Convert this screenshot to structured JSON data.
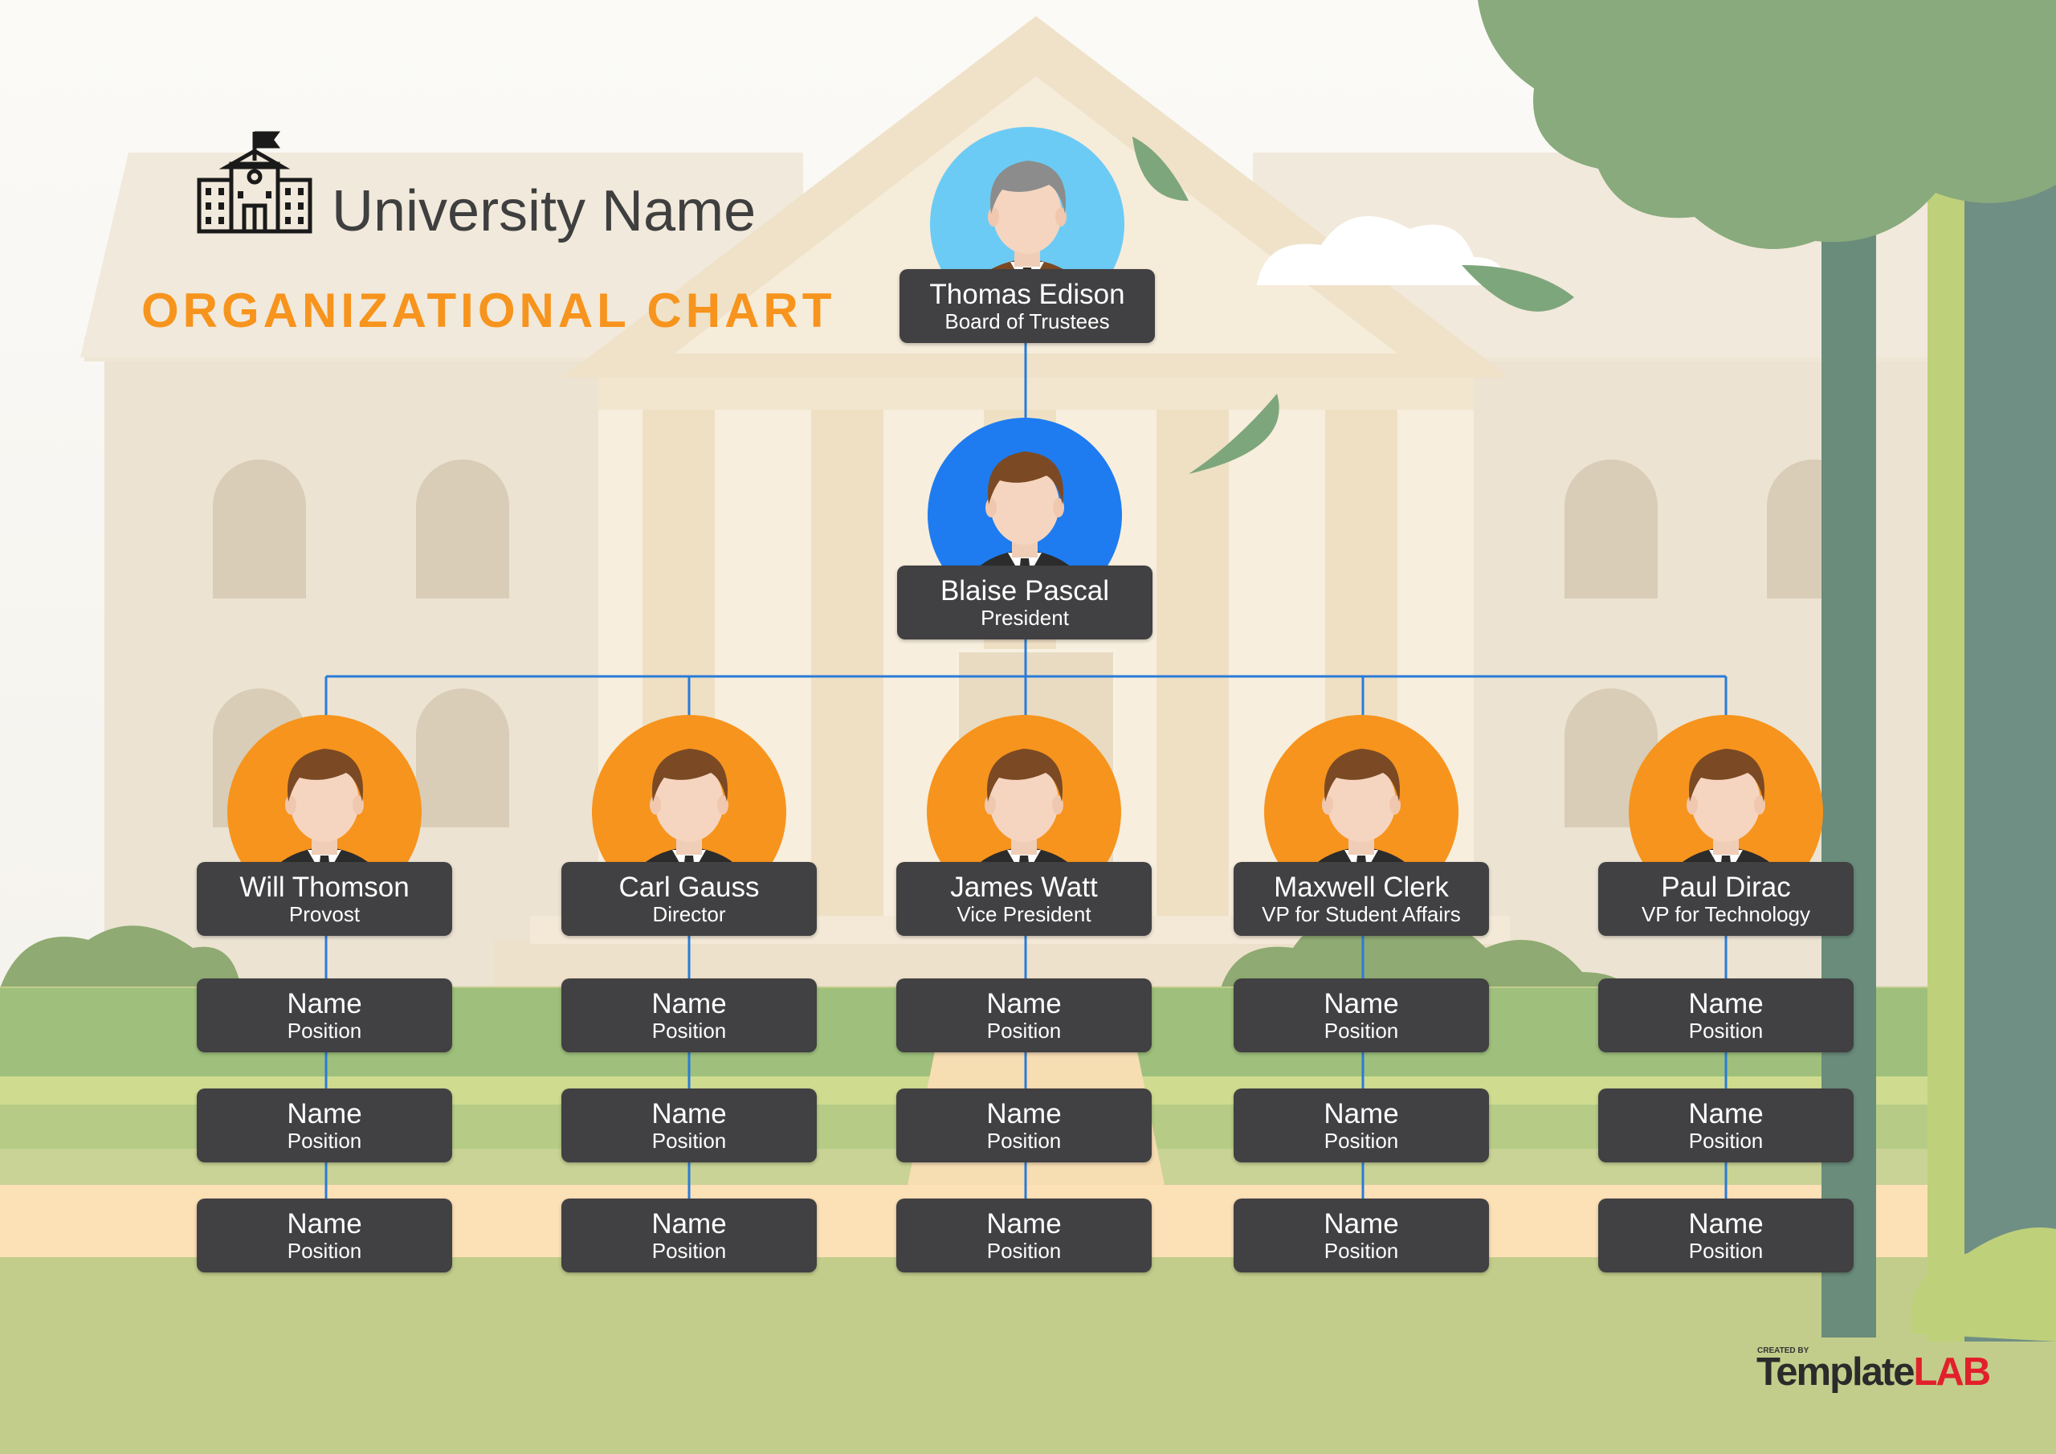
{
  "header": {
    "title": "University Name",
    "subtitle": "ORGANIZATIONAL CHART",
    "icon": "school-building-icon"
  },
  "colors": {
    "box": "#414042",
    "connector": "#2a7bd8",
    "subtitle": "#f7941d",
    "avatar_top": "#6ccbf5",
    "avatar_second": "#1e7cf0",
    "avatar_dept": "#f7941d"
  },
  "org": {
    "top": {
      "name": "Thomas Edison",
      "position": "Board of Trustees"
    },
    "president": {
      "name": "Blaise Pascal",
      "position": "President"
    },
    "departments": [
      {
        "name": "Will Thomson",
        "position": "Provost",
        "staff": [
          {
            "name": "Name",
            "position": "Position"
          },
          {
            "name": "Name",
            "position": "Position"
          },
          {
            "name": "Name",
            "position": "Position"
          }
        ]
      },
      {
        "name": "Carl Gauss",
        "position": "Director",
        "staff": [
          {
            "name": "Name",
            "position": "Position"
          },
          {
            "name": "Name",
            "position": "Position"
          },
          {
            "name": "Name",
            "position": "Position"
          }
        ]
      },
      {
        "name": "James Watt",
        "position": "Vice President",
        "staff": [
          {
            "name": "Name",
            "position": "Position"
          },
          {
            "name": "Name",
            "position": "Position"
          },
          {
            "name": "Name",
            "position": "Position"
          }
        ]
      },
      {
        "name": "Maxwell Clerk",
        "position": "VP for Student Affairs",
        "staff": [
          {
            "name": "Name",
            "position": "Position"
          },
          {
            "name": "Name",
            "position": "Position"
          },
          {
            "name": "Name",
            "position": "Position"
          }
        ]
      },
      {
        "name": "Paul Dirac",
        "position": "VP for Technology",
        "staff": [
          {
            "name": "Name",
            "position": "Position"
          },
          {
            "name": "Name",
            "position": "Position"
          },
          {
            "name": "Name",
            "position": "Position"
          }
        ]
      }
    ]
  },
  "logo": {
    "created_by": "CREATED BY",
    "part1": "Template",
    "part2": "LAB"
  }
}
